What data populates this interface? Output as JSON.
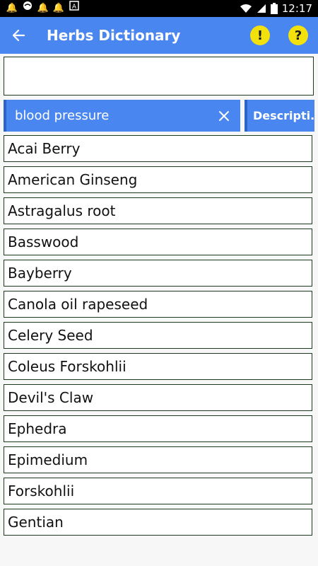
{
  "status_bar": {
    "time": "12:17",
    "left_icons": [
      "notification-icon",
      "vpn-icon",
      "notification-icon",
      "notification-icon",
      "a-box-icon"
    ],
    "right_icons": [
      "wifi-icon",
      "signal-icon",
      "battery-icon"
    ]
  },
  "app_bar": {
    "title": "Herbs Dictionary",
    "back_icon": "arrow-left-icon",
    "alert_label": "!",
    "help_label": "?",
    "color": "#4a86f0",
    "accent_yellow": "#f2e10c"
  },
  "input": {
    "value": ""
  },
  "search": {
    "query": "blood pressure",
    "description_label": "Descripti.."
  },
  "herbs": [
    "Acai Berry",
    "American Ginseng",
    "Astragalus root",
    "Basswood",
    "Bayberry",
    "Canola oil rapeseed",
    "Celery Seed",
    "Coleus Forskohlii",
    "Devil's Claw",
    "Ephedra",
    "Epimedium",
    "Forskohlii",
    "Gentian"
  ]
}
